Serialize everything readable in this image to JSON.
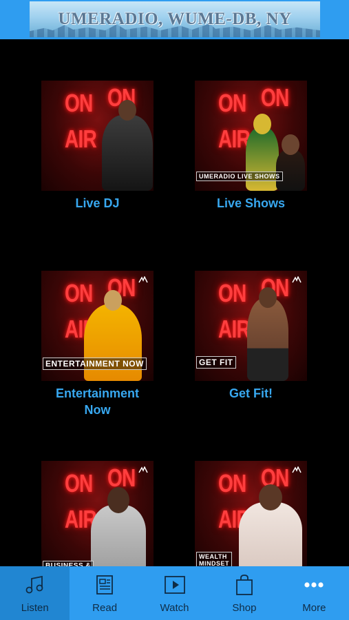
{
  "header": {
    "banner_title": "UMERADIO, WUME-DB, NY"
  },
  "tiles": [
    {
      "label": "Live DJ",
      "overlay": ""
    },
    {
      "label": "Live Shows",
      "overlay": "UMERADIO LIVE SHOWS"
    },
    {
      "label": "Entertainment Now",
      "overlay": "ENTERTAINMENT NOW"
    },
    {
      "label": "Get Fit!",
      "overlay": "GET FIT"
    },
    {
      "label": "",
      "overlay": "BUSINESS &"
    },
    {
      "label": "",
      "overlay": "WEALTH MINDSET"
    }
  ],
  "thumb_text": {
    "on": "ON",
    "air": "AIR"
  },
  "tabbar": {
    "items": [
      {
        "label": "Listen",
        "icon": "music-note-icon"
      },
      {
        "label": "Read",
        "icon": "newspaper-icon"
      },
      {
        "label": "Watch",
        "icon": "play-icon"
      },
      {
        "label": "Shop",
        "icon": "shopping-bag-icon"
      },
      {
        "label": "More",
        "icon": "more-dots-icon"
      }
    ],
    "active_index": 0
  },
  "colors": {
    "bar": "#2f9df0",
    "label": "#38a8f0",
    "on_air_red": "#ff3e3e"
  }
}
